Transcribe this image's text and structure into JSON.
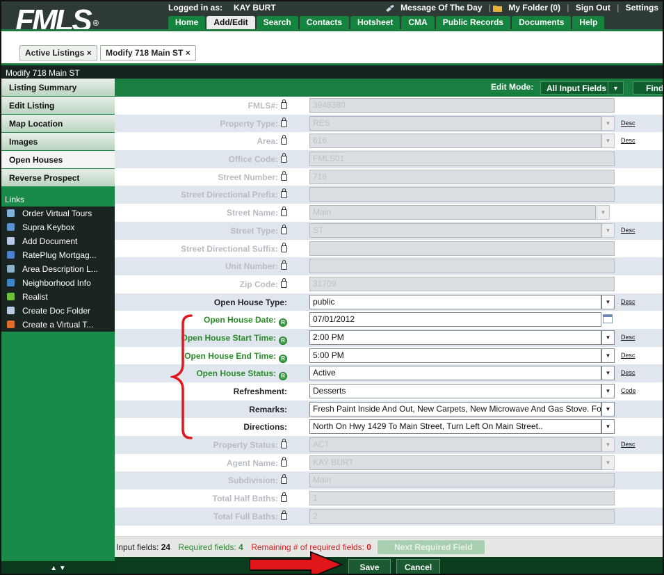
{
  "header": {
    "logo": "FMLS",
    "logo_mark": "®",
    "logged_in_label": "Logged in as:",
    "user": "KAY BURT",
    "motd": "Message Of The Day",
    "folder": "My Folder (0)",
    "signout": "Sign Out",
    "settings": "Settings",
    "sep": "|"
  },
  "nav": [
    "Home",
    "Add/Edit",
    "Search",
    "Contacts",
    "Hotsheet",
    "CMA",
    "Public Records",
    "Documents",
    "Help"
  ],
  "page_tabs": [
    {
      "label": "Active Listings",
      "close": "×"
    },
    {
      "label": "Modify 718 Main ST",
      "close": "×"
    }
  ],
  "breadcrumb": "Modify 718 Main ST",
  "sidebar": {
    "items": [
      "Listing Summary",
      "Edit Listing",
      "Map Location",
      "Images",
      "Open Houses",
      "Reverse Prospect"
    ],
    "links_title": "Links",
    "links": [
      {
        "label": "Order Virtual Tours",
        "color": "#7fb0d8"
      },
      {
        "label": "Supra Keybox",
        "color": "#5a8fd0"
      },
      {
        "label": "Add Document",
        "color": "#b9c9e6"
      },
      {
        "label": "RatePlug Mortgag...",
        "color": "#4c7fd1"
      },
      {
        "label": "Area Description L...",
        "color": "#8fb0cc"
      },
      {
        "label": "Neighborhood Info",
        "color": "#3f86c8"
      },
      {
        "label": "Realist",
        "color": "#6fbf3a"
      },
      {
        "label": "Create Doc Folder",
        "color": "#b9c9e6"
      },
      {
        "label": "Create a Virtual T...",
        "color": "#e06a2a"
      }
    ],
    "footer": "▲ ▼"
  },
  "edit_bar": {
    "label": "Edit Mode:",
    "mode": "All Input Fields",
    "find": "Find"
  },
  "desc_label": "Desc",
  "code_label": "Code",
  "fields": [
    {
      "label": "FMLS#:",
      "value": "3948380",
      "state": "locked",
      "w": "w1",
      "dd": false,
      "link": ""
    },
    {
      "label": "Property Type:",
      "value": "RES",
      "state": "locked",
      "w": "w2",
      "dd": true,
      "link": "Desc"
    },
    {
      "label": "Area:",
      "value": "616",
      "state": "locked",
      "w": "w2",
      "dd": true,
      "link": "Desc"
    },
    {
      "label": "Office Code:",
      "value": "FMLS01",
      "state": "locked",
      "w": "w1",
      "dd": false,
      "link": ""
    },
    {
      "label": "Street Number:",
      "value": "718",
      "state": "locked",
      "w": "w1",
      "dd": false,
      "link": ""
    },
    {
      "label": "Street Directional Prefix:",
      "value": "",
      "state": "locked",
      "w": "w1",
      "dd": false,
      "link": ""
    },
    {
      "label": "Street Name:",
      "value": "Main",
      "state": "locked",
      "w": "w3",
      "dd": true,
      "link": ""
    },
    {
      "label": "Street Type:",
      "value": "ST",
      "state": "locked",
      "w": "w2",
      "dd": true,
      "link": "Desc"
    },
    {
      "label": "Street Directional Suffix:",
      "value": "",
      "state": "locked",
      "w": "w1",
      "dd": false,
      "link": ""
    },
    {
      "label": "Unit Number:",
      "value": "",
      "state": "locked",
      "w": "w1",
      "dd": false,
      "link": ""
    },
    {
      "label": "Zip Code:",
      "value": "31709",
      "state": "locked",
      "w": "w1",
      "dd": false,
      "link": ""
    },
    {
      "label": "Open House Type:",
      "value": "public",
      "state": "edit",
      "w": "w2",
      "dd": true,
      "link": "Desc"
    },
    {
      "label": "Open House Date:",
      "value": "07/01/2012",
      "state": "req",
      "w": "w2",
      "dd": false,
      "cal": true,
      "link": ""
    },
    {
      "label": "Open House Start Time:",
      "value": "2:00 PM",
      "state": "req",
      "w": "w2",
      "dd": true,
      "link": "Desc"
    },
    {
      "label": "Open House End Time:",
      "value": "5:00 PM",
      "state": "req",
      "w": "w2",
      "dd": true,
      "link": "Desc"
    },
    {
      "label": "Open House Status:",
      "value": "Active",
      "state": "req",
      "w": "w2",
      "dd": true,
      "link": "Desc"
    },
    {
      "label": "Refreshment:",
      "value": "Desserts",
      "state": "edit",
      "w": "w2",
      "dd": true,
      "link": "Code"
    },
    {
      "label": "Remarks:",
      "value": "Fresh Paint Inside And Out, New Carpets, New Microwave And Gas Stove. Fo",
      "state": "edit",
      "w": "w2",
      "dd": true,
      "link": ""
    },
    {
      "label": "Directions:",
      "value": "North On  Hwy 1429 To Main Street, Turn Left On Main Street..",
      "state": "edit",
      "w": "w2",
      "dd": true,
      "link": ""
    },
    {
      "label": "Property Status:",
      "value": "ACT",
      "state": "locked",
      "w": "w2",
      "dd": true,
      "link": "Desc"
    },
    {
      "label": "Agent Name:",
      "value": "KAY BURT",
      "state": "locked",
      "w": "w2",
      "dd": true,
      "link": ""
    },
    {
      "label": "Subdivision:",
      "value": "Main",
      "state": "locked",
      "w": "w1",
      "dd": false,
      "link": ""
    },
    {
      "label": "Total Half Baths:",
      "value": "1",
      "state": "locked",
      "w": "w1",
      "dd": false,
      "link": ""
    },
    {
      "label": "Total Full Baths:",
      "value": "2",
      "state": "locked",
      "w": "w1",
      "dd": false,
      "link": ""
    }
  ],
  "status": {
    "input_label": "Input fields:",
    "input_count": "24",
    "required_label": "Required fields:",
    "required_count": "4",
    "remaining_label": "Remaining # of required fields:",
    "remaining_count": "0",
    "next_required": "Next Required Field"
  },
  "buttons": {
    "save": "Save",
    "cancel": "Cancel"
  },
  "colors": {
    "brand_green": "#1a8a48",
    "dark": "#172321",
    "required": "#2a8a2a",
    "remaining": "#d42020",
    "annotation": "#e0161b"
  }
}
